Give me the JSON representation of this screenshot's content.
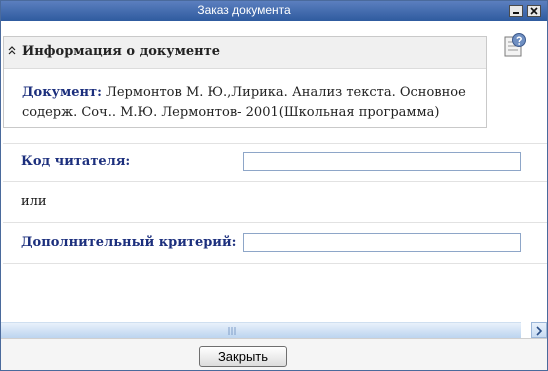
{
  "window": {
    "title": "Заказ документа"
  },
  "info_panel": {
    "title": "Информация о документе",
    "document_label": "Документ:",
    "document_text": "Лермонтов М. Ю.,Лирика. Анализ текста. Основное содерж. Соч.. М.Ю. Лермонтов- 2001(Школьная программа)"
  },
  "form": {
    "reader_code_label": "Код читателя",
    "reader_code_value": "",
    "or_text": "или",
    "additional_label": "Дополнительный критерий",
    "additional_value": "",
    "colon": ":"
  },
  "footer": {
    "close_label": "Закрыть"
  },
  "icons": {
    "toggle": "chevron-up-icon",
    "help": "help-document-icon",
    "minimize": "minimize-icon",
    "close": "close-icon"
  },
  "colors": {
    "titlebar": "#3a63a8",
    "label": "#1c2f7d"
  }
}
